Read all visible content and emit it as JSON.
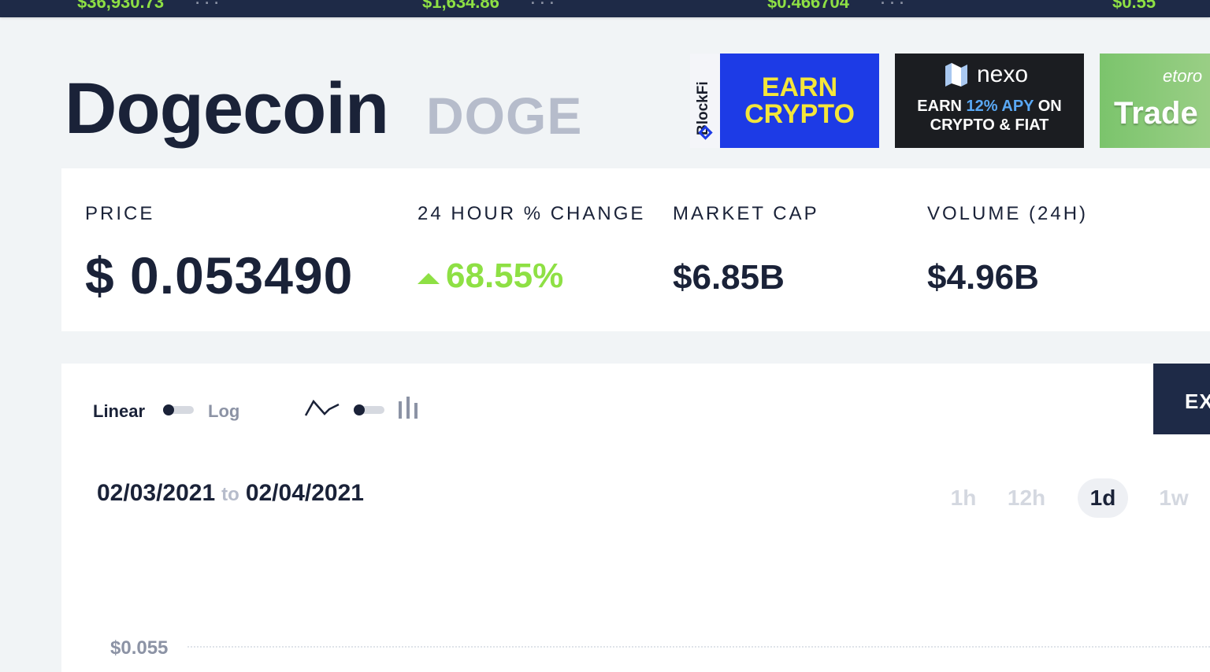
{
  "ticker": {
    "items": [
      "$36,930.73",
      "$1,634.86",
      "$0.466704",
      "$0.55"
    ]
  },
  "header": {
    "name": "Dogecoin",
    "symbol": "DOGE"
  },
  "ads": {
    "blockfi": {
      "brand": "BlockFi",
      "line1": "EARN",
      "line2": "CRYPTO"
    },
    "nexo": {
      "brand": "nexo",
      "line1_a": "EARN ",
      "line1_hl": "12% APY",
      "line1_b": " ON",
      "line2": "CRYPTO & FIAT"
    },
    "etoro": {
      "brand": "etoro",
      "text": "Trade"
    }
  },
  "stats": {
    "price_label": "PRICE",
    "price_value": "$ 0.053490",
    "change_label": "24 HOUR % CHANGE",
    "change_value": "68.55%",
    "mcap_label": "MARKET CAP",
    "mcap_value": "$6.85B",
    "volume_label": "VOLUME (24H)",
    "volume_value": "$4.96B"
  },
  "chart_controls": {
    "linear_label": "Linear",
    "log_label": "Log",
    "export_label": "EX",
    "date_from": "02/03/2021",
    "date_to_word": "to",
    "date_to": "02/04/2021",
    "timeframes": [
      "1h",
      "12h",
      "1d",
      "1w"
    ],
    "active_timeframe": "1d",
    "y_axis_top": "$0.055"
  },
  "colors": {
    "navy": "#1e2a47",
    "positive": "#8ee044",
    "muted": "#b6bccb"
  }
}
